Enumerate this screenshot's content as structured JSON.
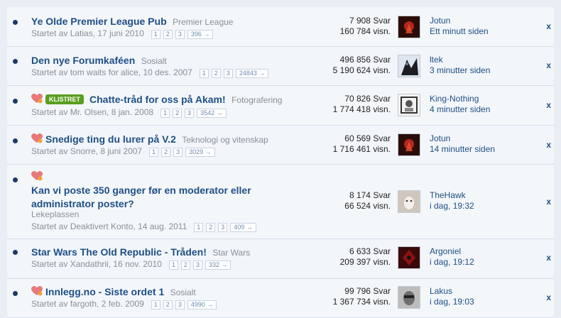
{
  "threads": [
    {
      "title": "Ye Olde Premier League Pub",
      "forum": "Premier League",
      "started": "Startet av Latias, 17 juni 2010",
      "pages": [
        "1",
        "2",
        "3",
        "396 →"
      ],
      "replies": "7 908 Svar",
      "views": "160 784 visn.",
      "last_user": "Jotun",
      "last_time": "Ett minutt siden"
    },
    {
      "title": "Den nye Forumkaféen",
      "forum": "Sosialt",
      "started": "Startet av tom waits for alice, 10 des. 2007",
      "pages": [
        "1",
        "2",
        "3",
        "24843 →"
      ],
      "replies": "496 856 Svar",
      "views": "5 190 624 visn.",
      "last_user": "ltek",
      "last_time": "3 minutter siden"
    },
    {
      "badge": "KLISTRET",
      "title": "Chatte-tråd for oss på Akam!",
      "forum": "Fotografering",
      "started": "Startet av Mr. Olsen, 8 jan. 2008",
      "pages": [
        "1",
        "2",
        "3",
        "3542 →"
      ],
      "replies": "70 826 Svar",
      "views": "1 774 418 visn.",
      "last_user": "King-Nothing",
      "last_time": "4 minutter siden"
    },
    {
      "title": "Snedige ting du lurer på V.2",
      "forum": "Teknologi og vitenskap",
      "started": "Startet av Snorre, 8 juni 2007",
      "pages": [
        "1",
        "2",
        "3",
        "3029 →"
      ],
      "replies": "60 569 Svar",
      "views": "1 716 461 visn.",
      "last_user": "Jotun",
      "last_time": "14 minutter siden"
    },
    {
      "title_line1": "Kan vi poste 350 ganger før en moderator eller",
      "title_line2": "administrator poster?",
      "forum": "Lekeplassen",
      "started": "Startet av Deaktivert Konto, 14 aug. 2011",
      "pages": [
        "1",
        "2",
        "3",
        "409 →"
      ],
      "replies": "8 174 Svar",
      "views": "66 524 visn.",
      "last_user": "TheHawk",
      "last_time": "i dag, 19:32"
    },
    {
      "title": "Star Wars The Old Republic - Tråden!",
      "forum": "Star Wars",
      "started": "Startet av Xandathrii, 16 nov. 2010",
      "pages": [
        "1",
        "2",
        "3",
        "332 →"
      ],
      "replies": "6 633 Svar",
      "views": "209 397 visn.",
      "last_user": "Argoniel",
      "last_time": "i dag, 19:12"
    },
    {
      "title": "Innlegg.no - Siste ordet 1",
      "forum": "Sosialt",
      "started": "Startet av fargoth, 2 feb. 2009",
      "pages": [
        "1",
        "2",
        "3",
        "4990 →"
      ],
      "replies": "99 796 Svar",
      "views": "1 367 734 visn.",
      "last_user": "Lakus",
      "last_time": "i dag, 19:03"
    }
  ],
  "close_label": "x",
  "colors": {
    "link": "#1e4f86",
    "badge": "#5a9e1f",
    "muted": "#8a9098"
  },
  "icons": {
    "hot": "heart-hot-icon",
    "unread": "unread-dot-icon"
  }
}
